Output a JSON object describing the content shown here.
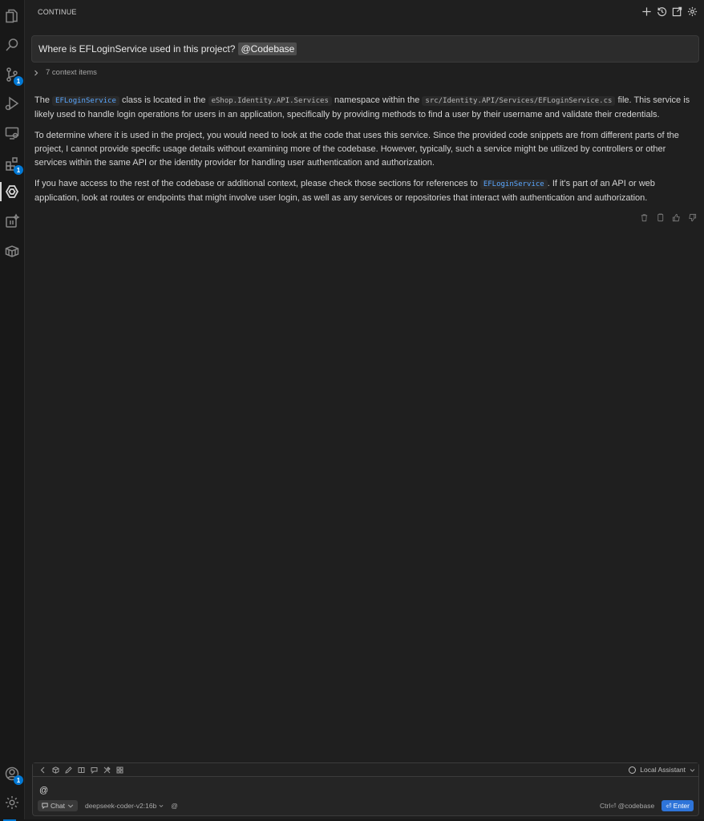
{
  "header": {
    "title": "CONTINUE",
    "actions": [
      "plus-icon",
      "history-icon",
      "open-external-icon",
      "gear-icon"
    ]
  },
  "activity_bar": {
    "items": [
      {
        "icon": "files-icon"
      },
      {
        "icon": "search-icon"
      },
      {
        "icon": "source-control-icon",
        "badge": "1"
      },
      {
        "icon": "run-debug-icon"
      },
      {
        "icon": "remote-explorer-icon"
      },
      {
        "icon": "extensions-icon",
        "badge": "1"
      },
      {
        "icon": "continue-icon",
        "active": true
      },
      {
        "icon": "ai-toolkit-icon"
      },
      {
        "icon": "containers-icon"
      },
      {
        "icon": "accounts-icon",
        "badge": "1"
      },
      {
        "icon": "manage-gear-icon"
      }
    ]
  },
  "user_message": {
    "text": "Where is EFLoginService used in this project?",
    "mention": "@Codebase"
  },
  "context": {
    "label": "7 context items"
  },
  "response": {
    "p1": {
      "t1": "The",
      "code1": "EFLoginService",
      "t2": "class is located in the",
      "code2": "eShop.Identity.API.Services",
      "t3": "namespace within the",
      "code3": "src/Identity.API/Services/EFLoginService.cs",
      "t4": "file. This service is likely used to handle login operations for users in an application, specifically by providing methods to find a user by their username and validate their credentials."
    },
    "p2": "To determine where it is used in the project, you would need to look at the code that uses this service. Since the provided code snippets are from different parts of the project, I cannot provide specific usage details without examining more of the codebase. However, typically, such a service might be utilized by controllers or other services within the same API or the identity provider for handling user authentication and authorization.",
    "p3": {
      "t1": "If you have access to the rest of the codebase or additional context, please check those sections for references to",
      "code1": "EFLoginService",
      "t2": ". If it's part of an API or web application, look at routes or endpoints that might involve user login, as well as any services or repositories that interact with authentication and authorization."
    }
  },
  "response_actions": [
    "trash-icon",
    "copy-icon",
    "thumbs-up-icon",
    "thumbs-down-icon"
  ],
  "input": {
    "toolbar_icons": [
      "chevron-left-icon",
      "cube-icon",
      "pencil-icon",
      "book-icon",
      "comment-icon",
      "tools-icon",
      "grid-icon"
    ],
    "assistant_label": "Local Assistant",
    "value": "@",
    "mode_label": "Chat",
    "model_label": "deepseek-coder-v2:16b",
    "at_label": "@",
    "shortcut_label": "Ctrl⏎ @codebase",
    "enter_label": "⏎ Enter"
  },
  "colors": {
    "background": "#1f1f1f",
    "activity_bar": "#181818",
    "accent": "#0078d4",
    "code_highlight": "#5aa7ff",
    "enter_button": "#2e74d9"
  }
}
